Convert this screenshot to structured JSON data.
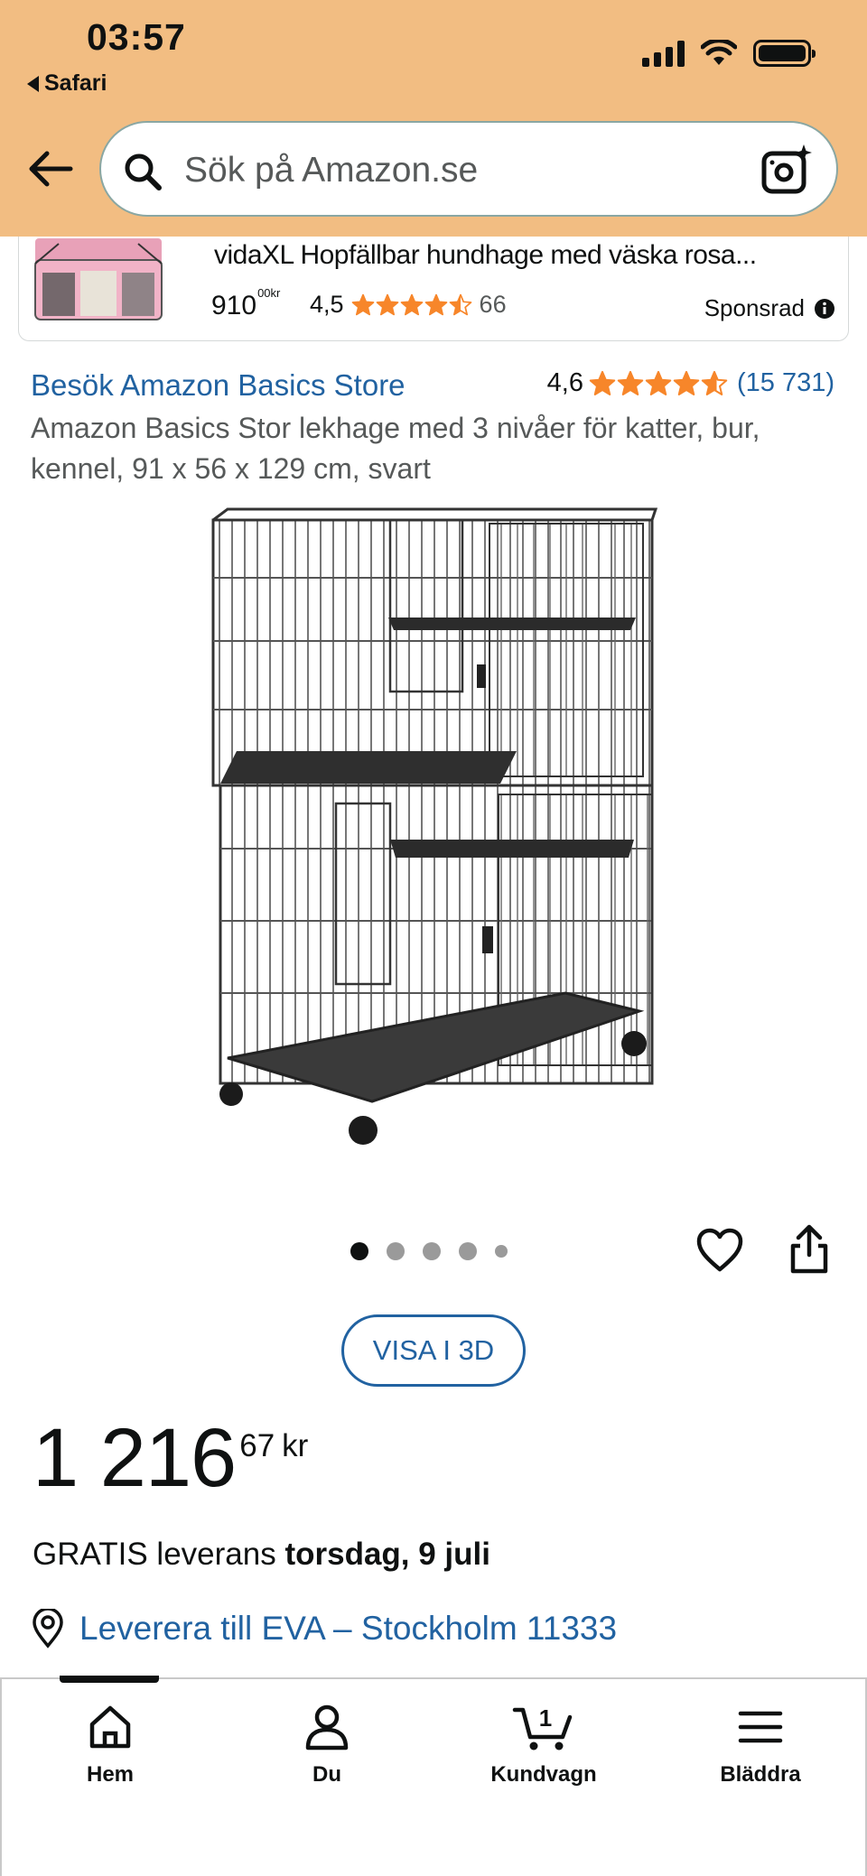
{
  "status_bar": {
    "time": "03:57",
    "back_app": "Safari"
  },
  "search": {
    "placeholder": "Sök på Amazon.se"
  },
  "sponsored": {
    "title": "vidaXL Hopfällbar hundhage med väska rosa...",
    "price_whole": "910",
    "price_fraction": "00",
    "price_currency": "kr",
    "rating": "4,5",
    "rating_value": 4.5,
    "review_count": "66",
    "label": "Sponsrad"
  },
  "product": {
    "store_link": "Besök Amazon Basics Store",
    "rating": "4,6",
    "rating_value": 4.6,
    "review_count": "(15 731)",
    "title": "Amazon Basics Stor lekhage med 3 nivåer för katter, bur, kennel, 91 x 56 x 129 cm, svart",
    "image_dots": {
      "count": 5,
      "active": 1
    },
    "view_3d": "VISA I 3D",
    "price_whole": "1 216",
    "price_fraction": "67",
    "price_currency": "kr",
    "delivery_prefix": "GRATIS leverans",
    "delivery_date": "torsdag, 9 juli",
    "deliver_to": "Leverera till EVA – Stockholm 11333"
  },
  "bottom_nav": {
    "items": [
      {
        "label": "Hem",
        "icon": "home-icon"
      },
      {
        "label": "Du",
        "icon": "person-icon"
      },
      {
        "label": "Kundvagn",
        "icon": "cart-icon",
        "badge": "1"
      },
      {
        "label": "Bläddra",
        "icon": "menu-icon"
      }
    ],
    "active_index": 0
  },
  "colors": {
    "header": "#f2bd82",
    "link": "#2162a1",
    "star": "#f7862a"
  }
}
